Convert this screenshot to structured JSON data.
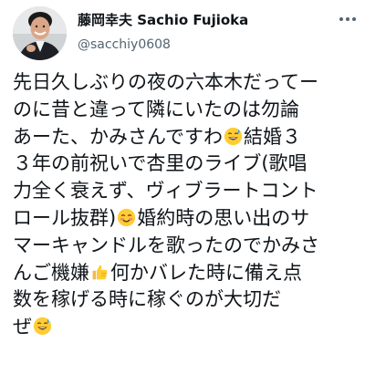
{
  "user": {
    "display_name": "藤岡幸夫 Sachio Fujioka",
    "handle": "@sacchiy0608"
  },
  "icons": {
    "more": "more-options-icon",
    "sweat_smile": "grinning-face-with-sweat-emoji",
    "smiling_blush": "smiling-face-with-smiling-eyes-emoji",
    "thumbs_up": "thumbs-up-emoji"
  },
  "tweet": {
    "lines": {
      "l1": "先日久しぶりの夜の六本木だってー",
      "l2": "のに昔と違って隣にいたのは勿論",
      "l3a": "あーた、かみさんですわ",
      "l3b": "結婚３",
      "l4": "３年の前祝いで杏里のライブ(歌唱",
      "l5": "力全く衰えず、ヴィブラートコント",
      "l6a": "ロール抜群)",
      "l6b": "婚約時の思い出のサ",
      "l7": "マーキャンドルを歌ったのでかみさ",
      "l8a": "んご機嫌",
      "l8b": "何かバレた時に備え点",
      "l9": "数を稼げる時に稼ぐのが大切だ",
      "l10": "ぜ"
    }
  }
}
